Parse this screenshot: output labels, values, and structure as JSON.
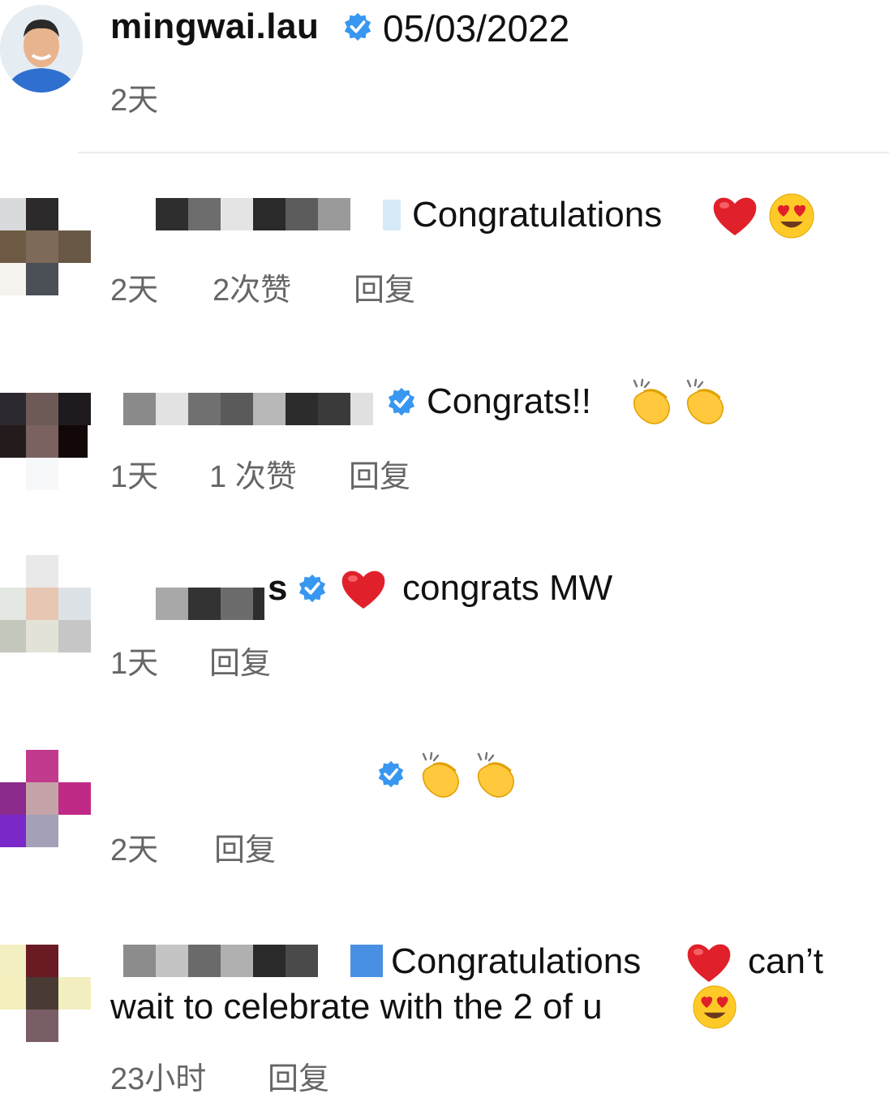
{
  "post": {
    "username": "mingwai.lau",
    "date": "05/03/2022",
    "age": "2天"
  },
  "comments": [
    {
      "text": "Congratulations",
      "age": "2天",
      "likes": "2次赞",
      "reply": "回复"
    },
    {
      "text": "Congrats!!",
      "age": "1天",
      "likes": "1 次赞",
      "reply": "回复"
    },
    {
      "username_suffix": "s",
      "text": "congrats MW",
      "age": "1天",
      "reply": "回复"
    },
    {
      "age": "2天",
      "reply": "回复"
    },
    {
      "text_line1": "Congratulations",
      "text_line1_end": "can’t",
      "text_line2": "wait to celebrate with the 2 of u",
      "age": "23小时",
      "reply": "回复"
    }
  ],
  "colors": {
    "verified_blue": "#3897f0",
    "heart_red": "#e0202a",
    "meta_gray": "#666666",
    "emoji_yellow": "#ffca28"
  },
  "icons": [
    "verified-badge-icon",
    "red-heart-icon",
    "heart-eyes-emoji-icon",
    "clapping-hands-emoji-icon"
  ]
}
